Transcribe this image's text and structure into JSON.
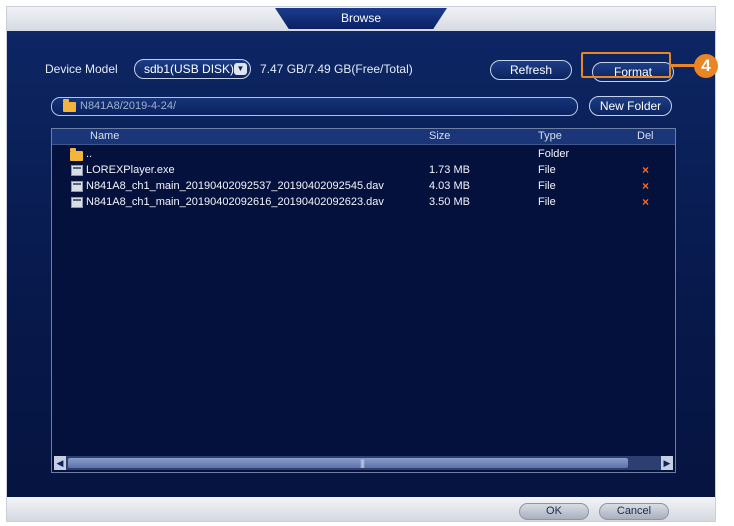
{
  "window": {
    "title": "Browse"
  },
  "device": {
    "model_label": "Device Model",
    "selected_device": "sdb1(USB DISK)",
    "capacity": "7.47 GB/7.49 GB(Free/Total)"
  },
  "toolbar": {
    "refresh_label": "Refresh",
    "format_label": "Format",
    "new_folder_label": "New Folder"
  },
  "path": {
    "value": "N841A8/2019-4-24/"
  },
  "table": {
    "headers": {
      "name": "Name",
      "size": "Size",
      "type": "Type",
      "del": "Del"
    },
    "rows": [
      {
        "icon": "folder-icon",
        "name": "..",
        "size": "",
        "type": "Folder",
        "deletable": false
      },
      {
        "icon": "file-icon",
        "name": "LOREXPlayer.exe",
        "size": "1.73 MB",
        "type": "File",
        "deletable": true
      },
      {
        "icon": "file-icon",
        "name": "N841A8_ch1_main_20190402092537_20190402092545.dav",
        "size": "4.03 MB",
        "type": "File",
        "deletable": true
      },
      {
        "icon": "file-icon",
        "name": "N841A8_ch1_main_20190402092616_20190402092623.dav",
        "size": "3.50 MB",
        "type": "File",
        "deletable": true
      }
    ],
    "delete_glyph": "×"
  },
  "scroll": {
    "left_arrow": "◀",
    "right_arrow": "▶",
    "grip": "|||"
  },
  "footer": {
    "ok_label": "OK",
    "cancel_label": "Cancel"
  },
  "callout": {
    "number": "4",
    "color": "#e98523"
  }
}
